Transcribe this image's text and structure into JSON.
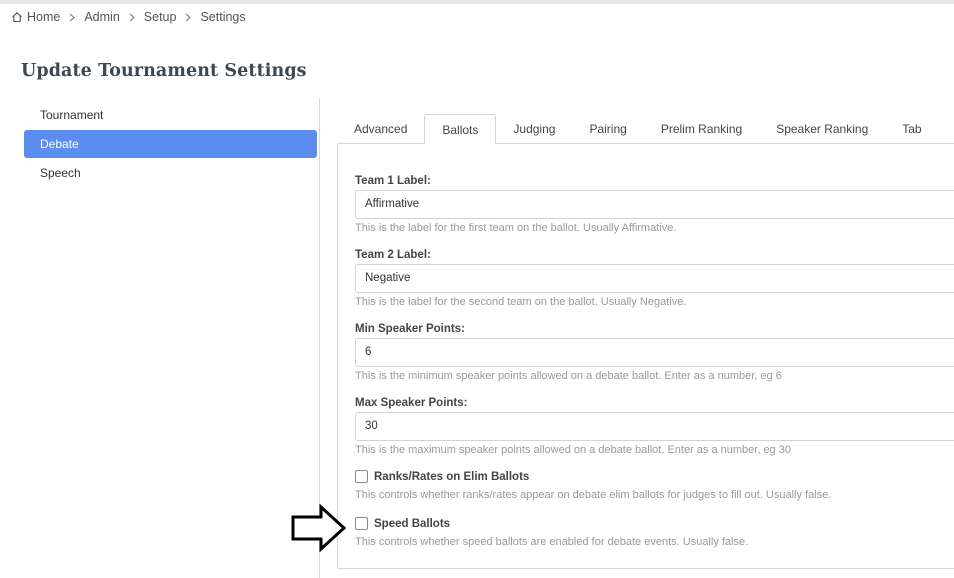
{
  "breadcrumb": {
    "items": [
      "Home",
      "Admin",
      "Setup",
      "Settings"
    ]
  },
  "page": {
    "title": "Update Tournament Settings"
  },
  "sidebar": {
    "items": [
      {
        "label": "Tournament",
        "active": false
      },
      {
        "label": "Debate",
        "active": true
      },
      {
        "label": "Speech",
        "active": false
      }
    ]
  },
  "tabs": [
    {
      "label": "Advanced",
      "active": false
    },
    {
      "label": "Ballots",
      "active": true
    },
    {
      "label": "Judging",
      "active": false
    },
    {
      "label": "Pairing",
      "active": false
    },
    {
      "label": "Prelim Ranking",
      "active": false
    },
    {
      "label": "Speaker Ranking",
      "active": false
    },
    {
      "label": "Tab",
      "active": false
    }
  ],
  "form": {
    "team1": {
      "label": "Team 1 Label:",
      "value": "Affirmative",
      "help": "This is the label for the first team on the ballot. Usually Affirmative."
    },
    "team2": {
      "label": "Team 2 Label:",
      "value": "Negative",
      "help": "This is the label for the second team on the ballot. Usually Negative."
    },
    "min_points": {
      "label": "Min Speaker Points:",
      "value": "6",
      "help": "This is the minimum speaker points allowed on a debate ballot. Enter as a number, eg 6"
    },
    "max_points": {
      "label": "Max Speaker Points:",
      "value": "30",
      "help": "This is the maximum speaker points allowed on a debate ballot. Enter as a number, eg 30"
    },
    "ranks_rates": {
      "label": "Ranks/Rates on Elim Ballots",
      "checked": false,
      "help": "This controls whether ranks/rates appear on debate elim ballots for judges to fill out. Usually false."
    },
    "speed_ballots": {
      "label": "Speed Ballots",
      "checked": false,
      "help": "This controls whether speed ballots are enabled for debate events. Usually false."
    }
  },
  "colors": {
    "accent": "#5b8def",
    "help_text": "#999999",
    "border": "#d5d5d5"
  },
  "icons": {
    "home": "home-icon",
    "separator": "chevron-right-icon",
    "annotation": "arrow-right-outline-icon"
  }
}
